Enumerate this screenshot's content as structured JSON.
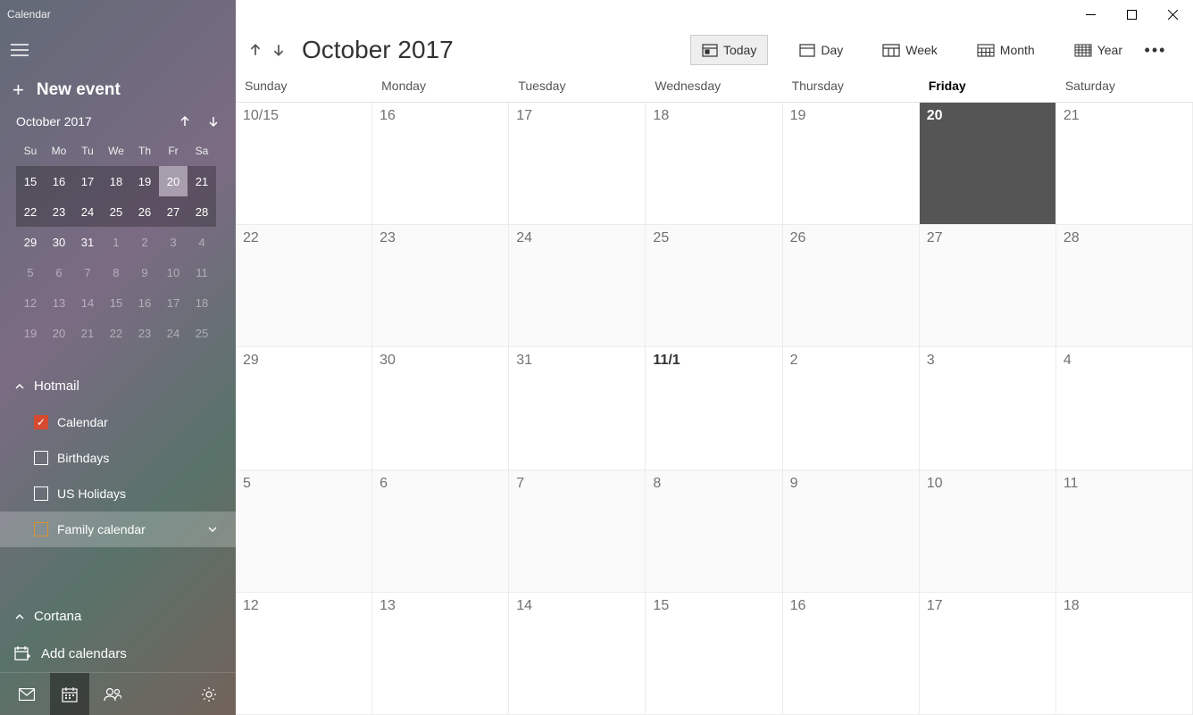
{
  "window": {
    "title": "Calendar"
  },
  "sidebar": {
    "new_event": "New event",
    "mini": {
      "title": "October 2017",
      "weekdays": [
        "Su",
        "Mo",
        "Tu",
        "We",
        "Th",
        "Fr",
        "Sa"
      ],
      "rows": [
        {
          "emph": true,
          "days": [
            {
              "n": "15"
            },
            {
              "n": "16"
            },
            {
              "n": "17"
            },
            {
              "n": "18"
            },
            {
              "n": "19"
            },
            {
              "n": "20",
              "sel": true
            },
            {
              "n": "21"
            }
          ]
        },
        {
          "emph": true,
          "days": [
            {
              "n": "22"
            },
            {
              "n": "23"
            },
            {
              "n": "24"
            },
            {
              "n": "25"
            },
            {
              "n": "26"
            },
            {
              "n": "27"
            },
            {
              "n": "28"
            }
          ]
        },
        {
          "emph": false,
          "days": [
            {
              "n": "29"
            },
            {
              "n": "30"
            },
            {
              "n": "31"
            },
            {
              "n": "1",
              "dim": true
            },
            {
              "n": "2",
              "dim": true
            },
            {
              "n": "3",
              "dim": true
            },
            {
              "n": "4",
              "dim": true
            }
          ]
        },
        {
          "emph": false,
          "days": [
            {
              "n": "5",
              "dim": true
            },
            {
              "n": "6",
              "dim": true
            },
            {
              "n": "7",
              "dim": true
            },
            {
              "n": "8",
              "dim": true
            },
            {
              "n": "9",
              "dim": true
            },
            {
              "n": "10",
              "dim": true
            },
            {
              "n": "11",
              "dim": true
            }
          ]
        },
        {
          "emph": false,
          "days": [
            {
              "n": "12",
              "dim": true
            },
            {
              "n": "13",
              "dim": true
            },
            {
              "n": "14",
              "dim": true
            },
            {
              "n": "15",
              "dim": true
            },
            {
              "n": "16",
              "dim": true
            },
            {
              "n": "17",
              "dim": true
            },
            {
              "n": "18",
              "dim": true
            }
          ]
        },
        {
          "emph": false,
          "days": [
            {
              "n": "19",
              "dim": true
            },
            {
              "n": "20",
              "dim": true
            },
            {
              "n": "21",
              "dim": true
            },
            {
              "n": "22",
              "dim": true
            },
            {
              "n": "23",
              "dim": true
            },
            {
              "n": "24",
              "dim": true
            },
            {
              "n": "25",
              "dim": true
            }
          ]
        }
      ]
    },
    "accounts": [
      {
        "name": "Hotmail",
        "calendars": [
          {
            "label": "Calendar",
            "checked": true,
            "color": "#d64b2f"
          },
          {
            "label": "Birthdays",
            "checked": false
          },
          {
            "label": "US Holidays",
            "checked": false
          },
          {
            "label": "Family calendar",
            "checked": false,
            "selected": true,
            "expandable": true,
            "outline": "#d6952f"
          }
        ]
      }
    ],
    "cortana": "Cortana",
    "add_calendars": "Add calendars"
  },
  "toolbar": {
    "title": "October 2017",
    "today": "Today",
    "views": [
      {
        "label": "Day"
      },
      {
        "label": "Week"
      },
      {
        "label": "Month"
      },
      {
        "label": "Year"
      }
    ]
  },
  "weekdays_full": [
    "Sunday",
    "Monday",
    "Tuesday",
    "Wednesday",
    "Thursday",
    "Friday",
    "Saturday"
  ],
  "today_index": 5,
  "month": {
    "rows": [
      [
        {
          "n": "10/15"
        },
        {
          "n": "16"
        },
        {
          "n": "17"
        },
        {
          "n": "18"
        },
        {
          "n": "19"
        },
        {
          "n": "20",
          "today": true
        },
        {
          "n": "21"
        }
      ],
      [
        {
          "n": "22"
        },
        {
          "n": "23"
        },
        {
          "n": "24"
        },
        {
          "n": "25"
        },
        {
          "n": "26"
        },
        {
          "n": "27"
        },
        {
          "n": "28"
        }
      ],
      [
        {
          "n": "29"
        },
        {
          "n": "30"
        },
        {
          "n": "31"
        },
        {
          "n": "11/1",
          "bold": true
        },
        {
          "n": "2"
        },
        {
          "n": "3"
        },
        {
          "n": "4"
        }
      ],
      [
        {
          "n": "5"
        },
        {
          "n": "6"
        },
        {
          "n": "7"
        },
        {
          "n": "8"
        },
        {
          "n": "9"
        },
        {
          "n": "10"
        },
        {
          "n": "11"
        }
      ],
      [
        {
          "n": "12"
        },
        {
          "n": "13"
        },
        {
          "n": "14"
        },
        {
          "n": "15"
        },
        {
          "n": "16"
        },
        {
          "n": "17"
        },
        {
          "n": "18"
        }
      ]
    ]
  }
}
